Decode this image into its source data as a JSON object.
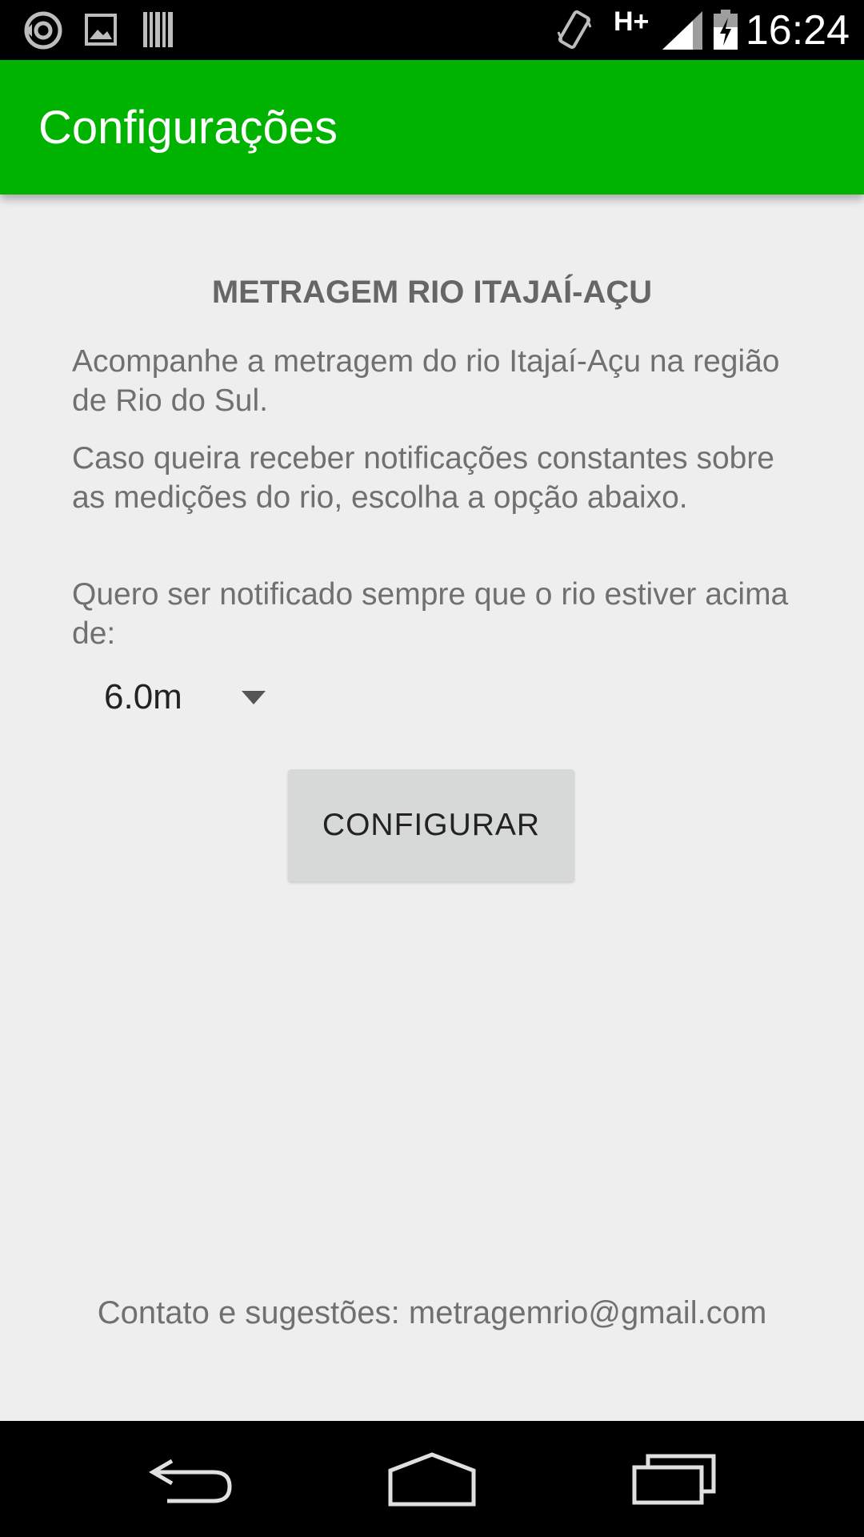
{
  "status_bar": {
    "time": "16:24",
    "network": "H+",
    "icons": [
      "sync-icon",
      "image-icon",
      "barcode-icon",
      "vibrate-icon",
      "signal-icon",
      "battery-charging-icon"
    ]
  },
  "app_bar": {
    "title": "Configurações",
    "color": "#00b300"
  },
  "main": {
    "heading": "METRAGEM RIO ITAJAÍ-AÇU",
    "paragraph1": "Acompanhe a metragem do rio Itajaí-Açu na região de Rio do Sul.",
    "paragraph2": "Caso queira receber notificações constantes sobre as medições do rio, escolha a opção abaixo.",
    "paragraph3": "Quero ser notificado sempre que o rio estiver acima de:",
    "threshold_selected": "6.0m",
    "configure_label": "CONFIGURAR",
    "contact": "Contato e sugestões: metragemrio@gmail.com"
  },
  "nav_bar": {
    "buttons": [
      "back-icon",
      "home-icon",
      "recents-icon"
    ]
  }
}
